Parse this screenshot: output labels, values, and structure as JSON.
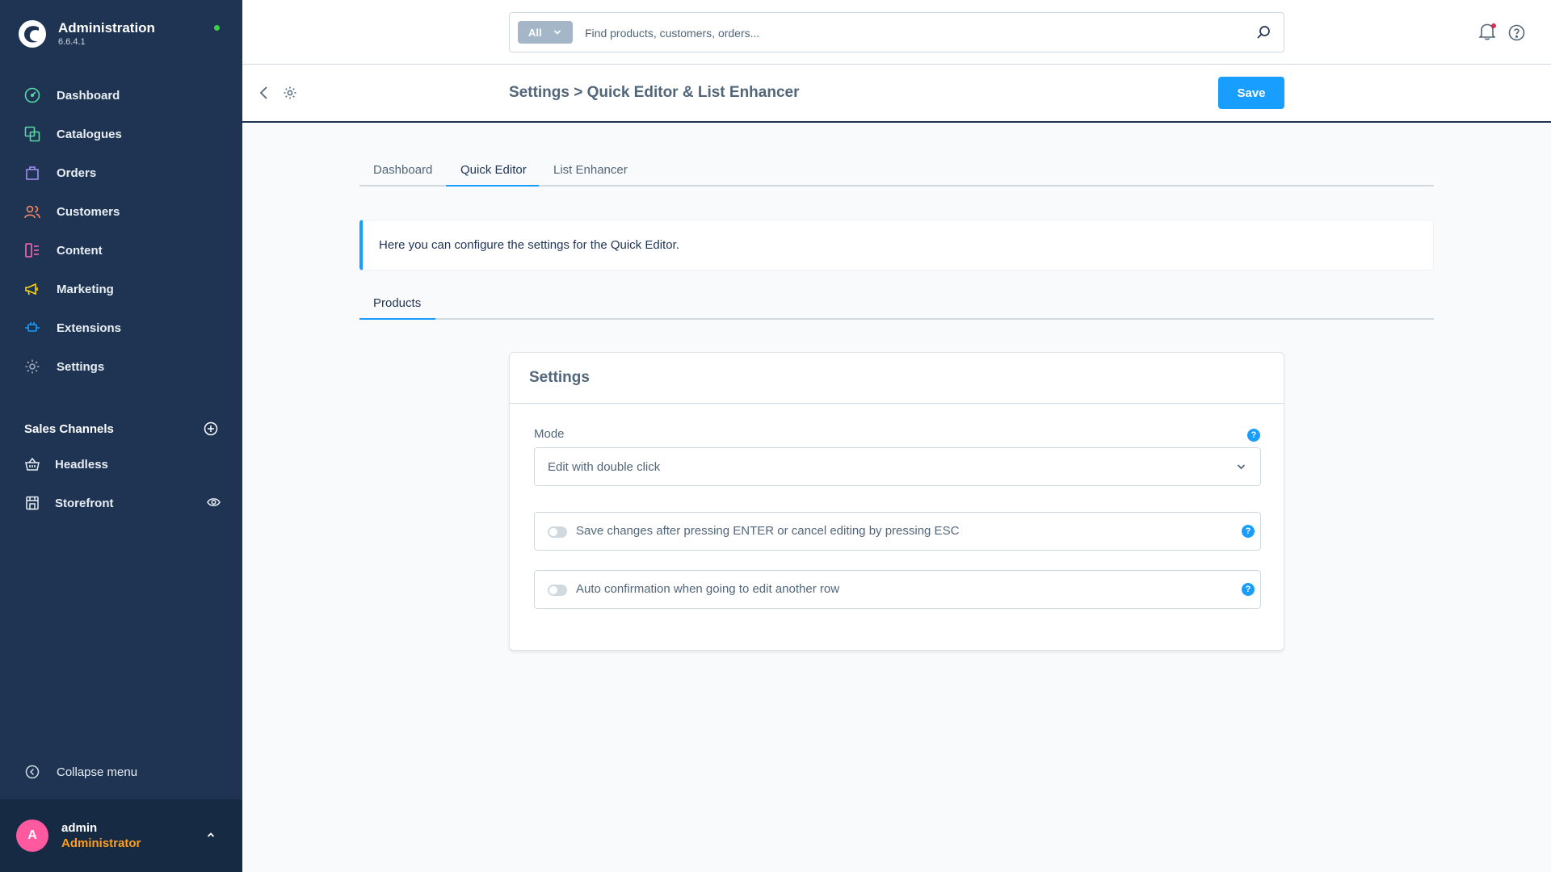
{
  "app": {
    "title": "Administration",
    "version": "6.6.4.1",
    "status_color": "#37d046"
  },
  "sidebar": {
    "items": [
      {
        "label": "Dashboard",
        "icon": "dashboard-icon",
        "color": "#57d9a3"
      },
      {
        "label": "Catalogues",
        "icon": "catalogues-icon",
        "color": "#57d9a3"
      },
      {
        "label": "Orders",
        "icon": "orders-icon",
        "color": "#a092f0"
      },
      {
        "label": "Customers",
        "icon": "customers-icon",
        "color": "#f88962"
      },
      {
        "label": "Content",
        "icon": "content-icon",
        "color": "#ff68b4"
      },
      {
        "label": "Marketing",
        "icon": "marketing-icon",
        "color": "#ffd700"
      },
      {
        "label": "Extensions",
        "icon": "extensions-icon",
        "color": "#189eff"
      },
      {
        "label": "Settings",
        "icon": "settings-icon",
        "color": "#9aa8b5"
      }
    ],
    "sales_channels": {
      "title": "Sales Channels",
      "items": [
        {
          "label": "Headless",
          "icon": "basket-icon"
        },
        {
          "label": "Storefront",
          "icon": "storefront-icon"
        }
      ]
    },
    "collapse_label": "Collapse menu",
    "user": {
      "initial": "A",
      "name": "admin",
      "role": "Administrator"
    }
  },
  "search": {
    "type_label": "All",
    "placeholder": "Find products, customers, orders..."
  },
  "smartbar": {
    "breadcrumb": "Settings > Quick Editor & List Enhancer",
    "save_label": "Save"
  },
  "tabs": [
    {
      "label": "Dashboard",
      "active": false
    },
    {
      "label": "Quick Editor",
      "active": true
    },
    {
      "label": "List Enhancer",
      "active": false
    }
  ],
  "alert": {
    "text": "Here you can configure the settings for the Quick Editor."
  },
  "subtabs": [
    {
      "label": "Products",
      "active": true
    }
  ],
  "card": {
    "title": "Settings",
    "mode": {
      "label": "Mode",
      "value": "Edit with double click"
    },
    "switches": [
      {
        "label": "Save changes after pressing ENTER or cancel editing by pressing ESC",
        "checked": false
      },
      {
        "label": "Auto confirmation when going to edit another row",
        "checked": false
      }
    ]
  },
  "colors": {
    "sidebar_bg": "#1f3453",
    "accent": "#189eff",
    "role": "#ff9f1c",
    "avatar": "#ff5aa0"
  }
}
